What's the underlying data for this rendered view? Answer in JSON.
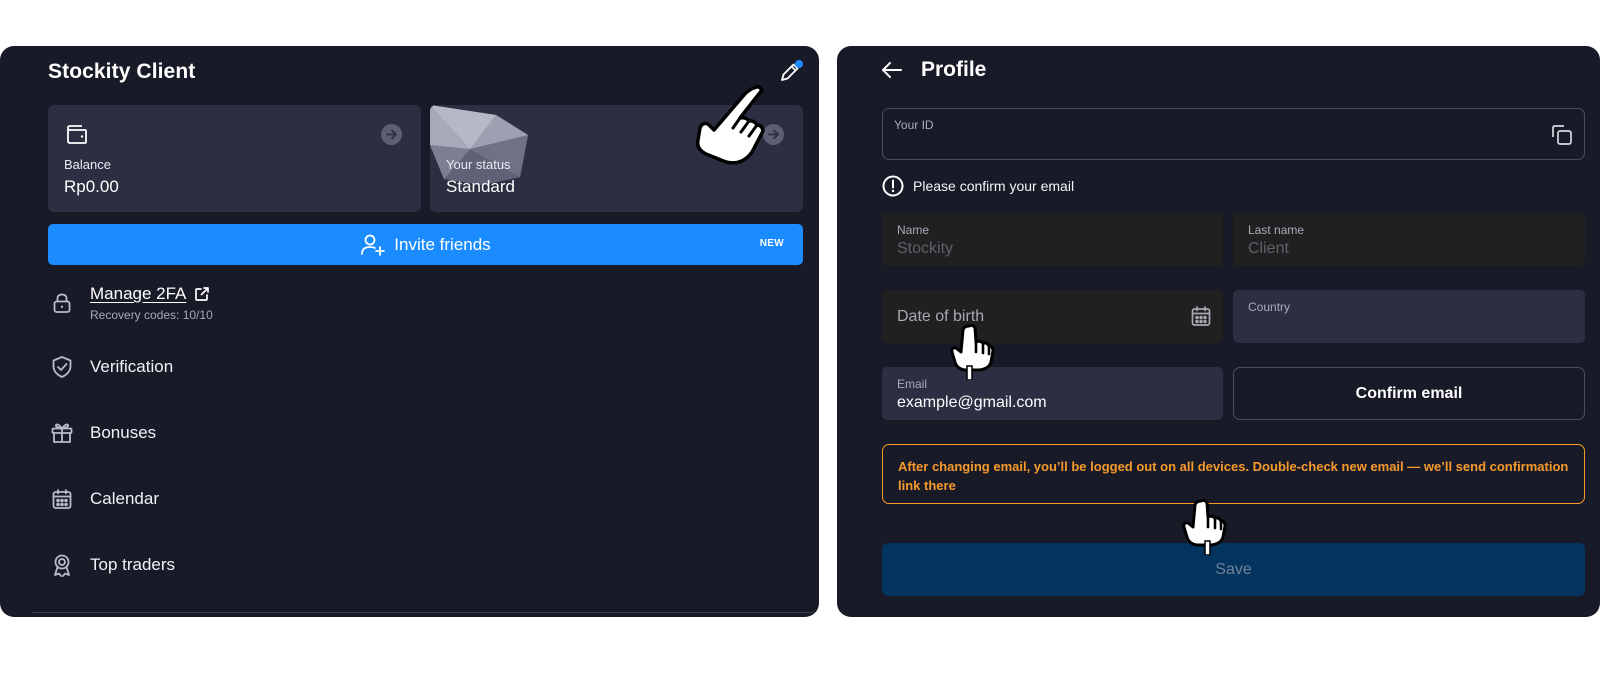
{
  "left": {
    "app_title": "Stockity Client",
    "balance_card": {
      "label": "Balance",
      "value": "Rp0.00"
    },
    "status_card": {
      "label": "Your status",
      "value": "Standard"
    },
    "invite": {
      "label": "Invite friends",
      "badge": "NEW"
    },
    "menu": {
      "twofa": {
        "label": "Manage 2FA",
        "sub": "Recovery codes: 10/10"
      },
      "verification": "Verification",
      "bonuses": "Bonuses",
      "calendar": "Calendar",
      "top_traders": "Top traders"
    },
    "icons": [
      "pencil-icon",
      "wallet-icon",
      "arrow-right-icon",
      "user-plus-icon",
      "lock-icon",
      "external-link-icon",
      "shield-check-icon",
      "gift-icon",
      "calendar-icon",
      "award-icon"
    ]
  },
  "right": {
    "page_title": "Profile",
    "your_id": {
      "label": "Your ID",
      "value": ""
    },
    "confirm_note": "Please confirm your email",
    "name": {
      "label": "Name",
      "placeholder": "Stockity"
    },
    "last_name": {
      "label": "Last name",
      "placeholder": "Client"
    },
    "date_of_birth": {
      "placeholder": "Date of birth"
    },
    "country": {
      "label": "Country",
      "value": ""
    },
    "email": {
      "label": "Email",
      "value": "example@gmail.com"
    },
    "confirm_email_button": "Confirm email",
    "warning": "After changing email, you’ll be logged out on all devices. Double-check new email — we’ll send confirmation link there",
    "save_button": "Save"
  },
  "colors": {
    "panel_bg": "#181a27",
    "card_bg": "#2c2f42",
    "accent_blue": "#1a8cff",
    "warning_orange": "#f79a2c",
    "save_bg": "#03345f"
  }
}
